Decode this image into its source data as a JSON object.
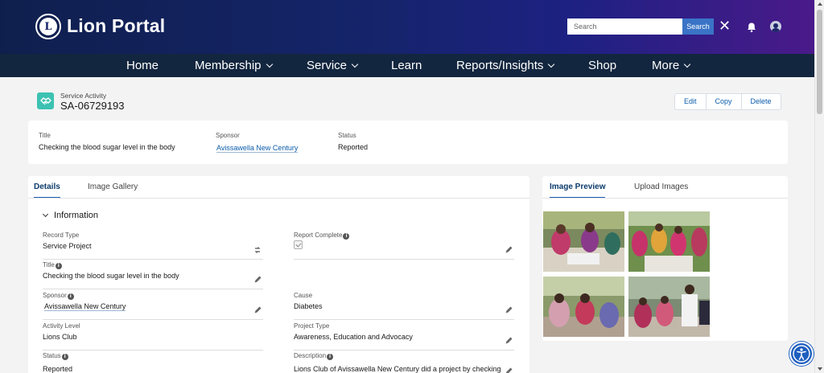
{
  "header": {
    "brand": "Lion Portal",
    "logo_text": "L",
    "search_placeholder": "Search",
    "search_button": "Search"
  },
  "nav": {
    "items": [
      {
        "label": "Home",
        "dropdown": false
      },
      {
        "label": "Membership",
        "dropdown": true
      },
      {
        "label": "Service",
        "dropdown": true
      },
      {
        "label": "Learn",
        "dropdown": false
      },
      {
        "label": "Reports/Insights",
        "dropdown": true
      },
      {
        "label": "Shop",
        "dropdown": false
      },
      {
        "label": "More",
        "dropdown": true
      }
    ]
  },
  "record": {
    "type_label": "Service Activity",
    "number": "SA-06729193",
    "actions": [
      "Edit",
      "Copy",
      "Delete"
    ]
  },
  "highlights": {
    "title_label": "Title",
    "title_value": "Checking the blood sugar level in the body",
    "sponsor_label": "Sponsor",
    "sponsor_value": "Avissawella New Century",
    "status_label": "Status",
    "status_value": "Reported"
  },
  "details": {
    "tabs": [
      "Details",
      "Image Gallery"
    ],
    "section_title": "Information",
    "fields": {
      "record_type": {
        "label": "Record Type",
        "value": "Service Project"
      },
      "report_complete": {
        "label": "Report Complete"
      },
      "title": {
        "label": "Title",
        "value": "Checking the blood sugar level in the body"
      },
      "sponsor": {
        "label": "Sponsor",
        "value": "Avissawella New Century"
      },
      "cause": {
        "label": "Cause",
        "value": "Diabetes"
      },
      "activity_level": {
        "label": "Activity Level",
        "value": "Lions Club"
      },
      "project_type": {
        "label": "Project Type",
        "value": "Awareness, Education and Advocacy"
      },
      "status": {
        "label": "Status",
        "value": "Reported"
      },
      "description": {
        "label": "Description",
        "value": "Lions Club of Avissawella New Century did a project by checking"
      }
    }
  },
  "images": {
    "tabs": [
      "Image Preview",
      "Upload Images"
    ]
  },
  "colors": {
    "accent": "#0b5cab",
    "nav_bg": "#13263f",
    "record_icon": "#3cc2b2"
  }
}
